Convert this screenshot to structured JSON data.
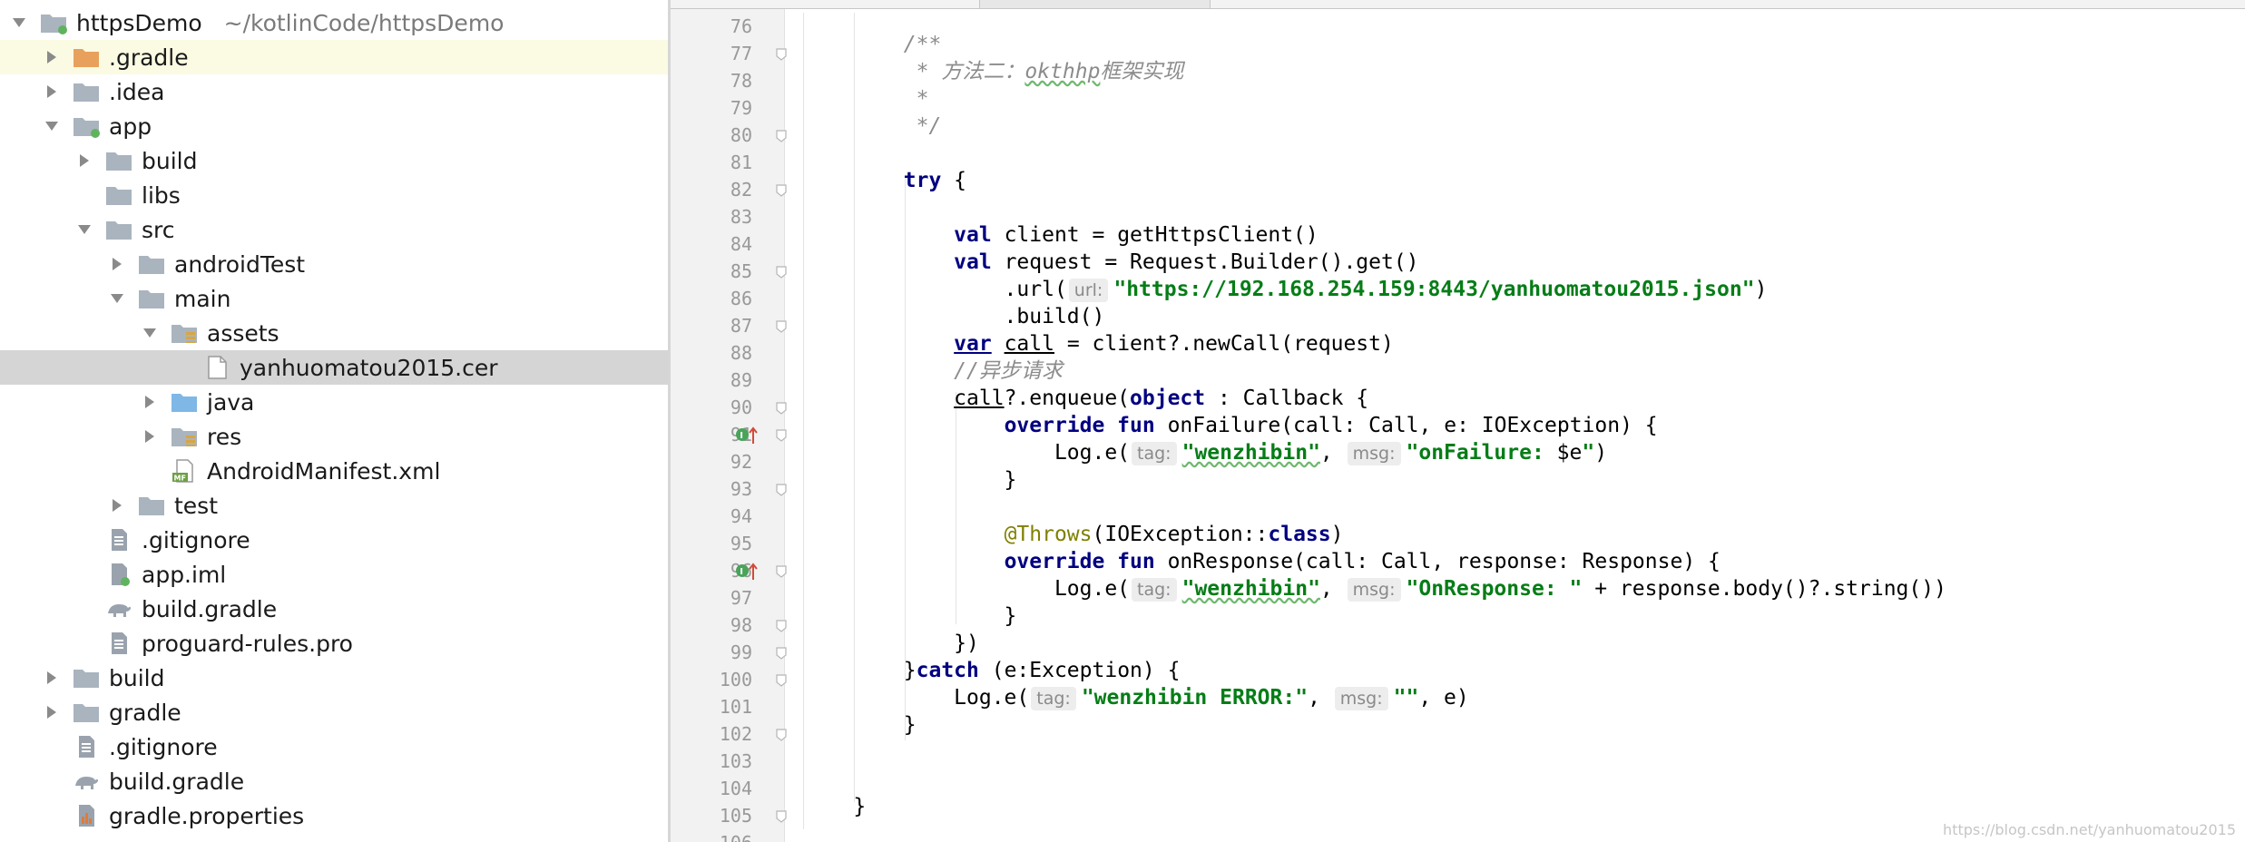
{
  "project_tree": {
    "rows": [
      {
        "label": "httpsDemo",
        "path": "~/kotlinCode/httpsDemo",
        "depth": 0,
        "arrow": "down",
        "icon": "module-folder"
      },
      {
        "label": ".gradle",
        "depth": 1,
        "arrow": "right",
        "icon": "folder-orange",
        "highlight": "yellow"
      },
      {
        "label": ".idea",
        "depth": 1,
        "arrow": "right",
        "icon": "folder"
      },
      {
        "label": "app",
        "depth": 1,
        "arrow": "down",
        "icon": "module-folder"
      },
      {
        "label": "build",
        "depth": 2,
        "arrow": "right",
        "icon": "folder"
      },
      {
        "label": "libs",
        "depth": 2,
        "arrow": "none",
        "icon": "folder"
      },
      {
        "label": "src",
        "depth": 2,
        "arrow": "down",
        "icon": "folder"
      },
      {
        "label": "androidTest",
        "depth": 3,
        "arrow": "right",
        "icon": "folder"
      },
      {
        "label": "main",
        "depth": 3,
        "arrow": "down",
        "icon": "folder"
      },
      {
        "label": "assets",
        "depth": 4,
        "arrow": "down",
        "icon": "resource-folder"
      },
      {
        "label": "yanhuomatou2015.cer",
        "depth": 5,
        "arrow": "none",
        "icon": "file",
        "highlight": "gray"
      },
      {
        "label": "java",
        "depth": 4,
        "arrow": "right",
        "icon": "folder-blue"
      },
      {
        "label": "res",
        "depth": 4,
        "arrow": "right",
        "icon": "resource-folder"
      },
      {
        "label": "AndroidManifest.xml",
        "depth": 4,
        "arrow": "none",
        "icon": "manifest-file"
      },
      {
        "label": "test",
        "depth": 3,
        "arrow": "right",
        "icon": "folder"
      },
      {
        "label": ".gitignore",
        "depth": 2,
        "arrow": "none",
        "icon": "text-file"
      },
      {
        "label": "app.iml",
        "depth": 2,
        "arrow": "none",
        "icon": "iml-file"
      },
      {
        "label": "build.gradle",
        "depth": 2,
        "arrow": "none",
        "icon": "gradle-file"
      },
      {
        "label": "proguard-rules.pro",
        "depth": 2,
        "arrow": "none",
        "icon": "text-file"
      },
      {
        "label": "build",
        "depth": 1,
        "arrow": "right",
        "icon": "folder"
      },
      {
        "label": "gradle",
        "depth": 1,
        "arrow": "right",
        "icon": "folder"
      },
      {
        "label": ".gitignore",
        "depth": 1,
        "arrow": "none",
        "icon": "text-file"
      },
      {
        "label": "build.gradle",
        "depth": 1,
        "arrow": "none",
        "icon": "gradle-file"
      },
      {
        "label": "gradle.properties",
        "depth": 1,
        "arrow": "none",
        "icon": "properties-file"
      }
    ]
  },
  "editor": {
    "lines": [
      {
        "n": "76",
        "fold": false,
        "mark": false,
        "t": []
      },
      {
        "n": "77",
        "fold": true,
        "mark": false,
        "t": [
          [
            "",
            "        "
          ],
          [
            "cmt",
            "/**"
          ]
        ]
      },
      {
        "n": "78",
        "fold": false,
        "mark": false,
        "t": [
          [
            "",
            "        "
          ],
          [
            "cmt",
            " * 方法二："
          ],
          [
            "cmt squig",
            "okthhp"
          ],
          [
            "cmt",
            "框架实现"
          ]
        ]
      },
      {
        "n": "79",
        "fold": false,
        "mark": false,
        "t": [
          [
            "",
            "        "
          ],
          [
            "cmt",
            " *"
          ]
        ]
      },
      {
        "n": "80",
        "fold": true,
        "mark": false,
        "t": [
          [
            "",
            "        "
          ],
          [
            "cmt",
            " */"
          ]
        ]
      },
      {
        "n": "81",
        "fold": false,
        "mark": false,
        "t": []
      },
      {
        "n": "82",
        "fold": true,
        "mark": false,
        "t": [
          [
            "",
            "        "
          ],
          [
            "kw",
            "try"
          ],
          [
            "",
            " {"
          ]
        ]
      },
      {
        "n": "83",
        "fold": false,
        "mark": false,
        "t": []
      },
      {
        "n": "84",
        "fold": false,
        "mark": false,
        "t": [
          [
            "",
            "            "
          ],
          [
            "kw",
            "val"
          ],
          [
            "",
            " client = getHttpsClient()"
          ]
        ]
      },
      {
        "n": "85",
        "fold": true,
        "mark": false,
        "t": [
          [
            "",
            "            "
          ],
          [
            "kw",
            "val"
          ],
          [
            "",
            " request = Request.Builder().get()"
          ]
        ]
      },
      {
        "n": "86",
        "fold": false,
        "mark": false,
        "t": [
          [
            "",
            "                .url("
          ],
          [
            "hint",
            "url:"
          ],
          [
            "str",
            "\"https://192.168.254.159:8443/yanhuomatou2015.json\""
          ],
          [
            "",
            ")"
          ]
        ]
      },
      {
        "n": "87",
        "fold": true,
        "mark": false,
        "t": [
          [
            "",
            "                .build()"
          ]
        ]
      },
      {
        "n": "88",
        "fold": false,
        "mark": false,
        "t": [
          [
            "",
            "            "
          ],
          [
            "kw ul",
            "var"
          ],
          [
            "",
            " "
          ],
          [
            "ul",
            "call"
          ],
          [
            "",
            " = client?.newCall(request)"
          ]
        ]
      },
      {
        "n": "89",
        "fold": false,
        "mark": false,
        "t": [
          [
            "",
            "            "
          ],
          [
            "cmt",
            "//异步请求"
          ]
        ]
      },
      {
        "n": "90",
        "fold": true,
        "mark": false,
        "t": [
          [
            "",
            "            "
          ],
          [
            "ul",
            "call"
          ],
          [
            "",
            "?.enqueue("
          ],
          [
            "kw",
            "object"
          ],
          [
            "",
            " : Callback {"
          ]
        ]
      },
      {
        "n": "91",
        "fold": true,
        "mark": true,
        "t": [
          [
            "",
            "                "
          ],
          [
            "kw",
            "override fun"
          ],
          [
            "",
            " onFailure(call: Call, e: IOException) {"
          ]
        ]
      },
      {
        "n": "92",
        "fold": false,
        "mark": false,
        "t": [
          [
            "",
            "                    Log.e("
          ],
          [
            "hint",
            "tag:"
          ],
          [
            "str squig",
            "\"wenzhibin\""
          ],
          [
            "",
            ", "
          ],
          [
            "hint",
            "msg:"
          ],
          [
            "str",
            "\"onFailure: "
          ],
          [
            "",
            "$e"
          ],
          [
            "str",
            "\""
          ],
          [
            "",
            ")"
          ]
        ]
      },
      {
        "n": "93",
        "fold": true,
        "mark": false,
        "t": [
          [
            "",
            "                }"
          ]
        ]
      },
      {
        "n": "94",
        "fold": false,
        "mark": false,
        "t": []
      },
      {
        "n": "95",
        "fold": false,
        "mark": false,
        "t": [
          [
            "",
            "                "
          ],
          [
            "ann",
            "@Throws"
          ],
          [
            "",
            "(IOException::"
          ],
          [
            "kw",
            "class"
          ],
          [
            "",
            ")"
          ]
        ]
      },
      {
        "n": "96",
        "fold": true,
        "mark": true,
        "t": [
          [
            "",
            "                "
          ],
          [
            "kw",
            "override fun"
          ],
          [
            "",
            " onResponse(call: Call, response: Response) {"
          ]
        ]
      },
      {
        "n": "97",
        "fold": false,
        "mark": false,
        "t": [
          [
            "",
            "                    Log.e("
          ],
          [
            "hint",
            "tag:"
          ],
          [
            "str squig",
            "\"wenzhibin\""
          ],
          [
            "",
            ", "
          ],
          [
            "hint",
            "msg:"
          ],
          [
            "str",
            "\"OnResponse: \""
          ],
          [
            "",
            " + response.body()?.string())"
          ]
        ]
      },
      {
        "n": "98",
        "fold": true,
        "mark": false,
        "t": [
          [
            "",
            "                }"
          ]
        ]
      },
      {
        "n": "99",
        "fold": true,
        "mark": false,
        "t": [
          [
            "",
            "            })"
          ]
        ]
      },
      {
        "n": "100",
        "fold": true,
        "mark": false,
        "t": [
          [
            "",
            "        }"
          ],
          [
            "kw",
            "catch"
          ],
          [
            "",
            " (e:Exception) {"
          ]
        ]
      },
      {
        "n": "101",
        "fold": false,
        "mark": false,
        "t": [
          [
            "",
            "            Log.e("
          ],
          [
            "hint",
            "tag:"
          ],
          [
            "str",
            "\"wenzhibin ERROR:\""
          ],
          [
            "",
            ", "
          ],
          [
            "hint",
            "msg:"
          ],
          [
            "str",
            "\"\""
          ],
          [
            "",
            ", e)"
          ]
        ]
      },
      {
        "n": "102",
        "fold": true,
        "mark": false,
        "t": [
          [
            "",
            "        }"
          ]
        ]
      },
      {
        "n": "103",
        "fold": false,
        "mark": false,
        "t": []
      },
      {
        "n": "104",
        "fold": false,
        "mark": false,
        "t": []
      },
      {
        "n": "105",
        "fold": true,
        "mark": false,
        "t": [
          [
            "",
            "    }"
          ]
        ]
      },
      {
        "n": "106",
        "fold": false,
        "mark": false,
        "t": []
      }
    ]
  },
  "watermark": "https://blog.csdn.net/yanhuomatou2015",
  "colors": {
    "keyword": "#000080",
    "string": "#067d17",
    "comment": "#8c8c8c",
    "annotation": "#808000",
    "folder": "#a9b4bf",
    "folder_orange": "#e8a15c",
    "folder_blue": "#7fb7e6",
    "selection": "#d5d5d5",
    "row_hint": "#fbfbe4"
  }
}
